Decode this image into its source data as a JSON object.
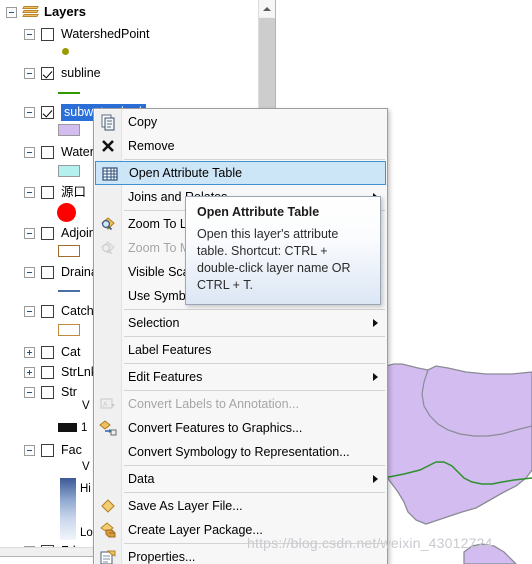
{
  "window": {
    "panel_title": "Layers"
  },
  "toc": {
    "root": {
      "label": "Layers",
      "icon": "layers-stack-icon",
      "expanded": true,
      "checked": null
    },
    "items": [
      {
        "label": "WatershedPoint",
        "checked": false,
        "expander": "minus",
        "legend": {
          "type": "point",
          "color": "#999900",
          "label": ""
        }
      },
      {
        "label": "subline",
        "checked": true,
        "expander": "minus",
        "legend": {
          "type": "line",
          "color": "#339900",
          "label": ""
        }
      },
      {
        "label": "subwatershed",
        "checked": true,
        "expander": "minus",
        "selected": true,
        "legend": {
          "type": "polygon",
          "fill": "#d3bdf0",
          "outline": "#9a9a9a",
          "label": ""
        }
      },
      {
        "label": "Watershed",
        "checked": false,
        "expander": "minus",
        "legend": {
          "type": "polygon",
          "fill": "#b3f0ee",
          "outline": "#9a9a9a",
          "label": ""
        }
      },
      {
        "label": "源口",
        "checked": false,
        "expander": "minus",
        "legend": {
          "type": "point",
          "color": "#ff0000",
          "label": ""
        }
      },
      {
        "label": "AdjoinCatchment",
        "checked": false,
        "expander": "minus",
        "legend": {
          "type": "polygon-outline",
          "outline": "#a06c2c",
          "label": ""
        }
      },
      {
        "label": "DrainageLine",
        "checked": false,
        "expander": "minus",
        "legend": {
          "type": "line",
          "color": "#4a6fa8",
          "label": ""
        }
      },
      {
        "label": "Catchment",
        "checked": false,
        "expander": "minus",
        "legend": {
          "type": "polygon-outline",
          "outline": "#c08a3e",
          "label": ""
        }
      },
      {
        "label": "Cat",
        "checked": false,
        "expander": "plus",
        "legend": null
      },
      {
        "label": "StrLnk",
        "checked": false,
        "expander": "plus",
        "legend": null
      },
      {
        "label": "Str",
        "checked": false,
        "expander": "minus",
        "legend": {
          "type": "value-bar",
          "color": "#121212",
          "value_label": "1",
          "header_label": "V"
        }
      },
      {
        "label": "Fac",
        "checked": false,
        "expander": "minus",
        "legend": {
          "type": "gradient",
          "high_label": "Hi",
          "low_label": "Lo",
          "header_label": "V"
        }
      },
      {
        "label": "Fdr",
        "checked": false,
        "expander": "minus",
        "legend": null
      }
    ],
    "scrollbar": {
      "up_icon": "chevron-up-icon"
    }
  },
  "context_menu": {
    "items": [
      {
        "label": "Copy",
        "icon": "copy-icon",
        "disabled": false,
        "submenu": false,
        "selected": false,
        "separator_after": false
      },
      {
        "label": "Remove",
        "icon": "remove-x-icon",
        "disabled": false,
        "submenu": false,
        "selected": false,
        "separator_after": true
      },
      {
        "label": "Open Attribute Table",
        "icon": "table-icon",
        "disabled": false,
        "submenu": false,
        "selected": true,
        "separator_after": false
      },
      {
        "label": "Joins and Relates",
        "icon": "",
        "disabled": false,
        "submenu": true,
        "selected": false,
        "separator_after": true
      },
      {
        "label": "Zoom To Layer",
        "icon": "zoom-to-layer-icon",
        "disabled": false,
        "submenu": false,
        "selected": false,
        "separator_after": false
      },
      {
        "label": "Zoom To Make Visible",
        "icon": "zoom-make-visible-icon",
        "disabled": true,
        "submenu": false,
        "selected": false,
        "separator_after": false
      },
      {
        "label": "Visible Scale Range",
        "icon": "",
        "disabled": false,
        "submenu": true,
        "selected": false,
        "separator_after": false
      },
      {
        "label": "Use Symbol Levels",
        "icon": "",
        "disabled": false,
        "submenu": false,
        "selected": false,
        "separator_after": true
      },
      {
        "label": "Selection",
        "icon": "",
        "disabled": false,
        "submenu": true,
        "selected": false,
        "separator_after": true
      },
      {
        "label": "Label Features",
        "icon": "",
        "disabled": false,
        "submenu": false,
        "selected": false,
        "separator_after": true
      },
      {
        "label": "Edit Features",
        "icon": "",
        "disabled": false,
        "submenu": true,
        "selected": false,
        "separator_after": true
      },
      {
        "label": "Convert Labels to Annotation...",
        "icon": "convert-labels-icon",
        "disabled": true,
        "submenu": false,
        "selected": false,
        "separator_after": false
      },
      {
        "label": "Convert Features to Graphics...",
        "icon": "convert-features-icon",
        "disabled": false,
        "submenu": false,
        "selected": false,
        "separator_after": false
      },
      {
        "label": "Convert Symbology to Representation...",
        "icon": "",
        "disabled": false,
        "submenu": false,
        "selected": false,
        "separator_after": true
      },
      {
        "label": "Data",
        "icon": "",
        "disabled": false,
        "submenu": true,
        "selected": false,
        "separator_after": true
      },
      {
        "label": "Save As Layer File...",
        "icon": "layer-file-icon",
        "disabled": false,
        "submenu": false,
        "selected": false,
        "separator_after": false
      },
      {
        "label": "Create Layer Package...",
        "icon": "layer-package-icon",
        "disabled": false,
        "submenu": false,
        "selected": false,
        "separator_after": true
      },
      {
        "label": "Properties...",
        "icon": "properties-icon",
        "disabled": false,
        "submenu": false,
        "selected": false,
        "separator_after": false
      }
    ]
  },
  "tooltip": {
    "title": "Open Attribute Table",
    "body": "Open this layer's attribute table. Shortcut: CTRL + double-click layer name OR CTRL + T."
  },
  "map": {
    "polygon_fill": "#d3bdf0",
    "polygon_outline": "#8a8a96",
    "stream_color": "#2f8f2f",
    "background": "#ffffff"
  },
  "watermark": {
    "text": "https://blog.csdn.net/weixin_43012724"
  }
}
